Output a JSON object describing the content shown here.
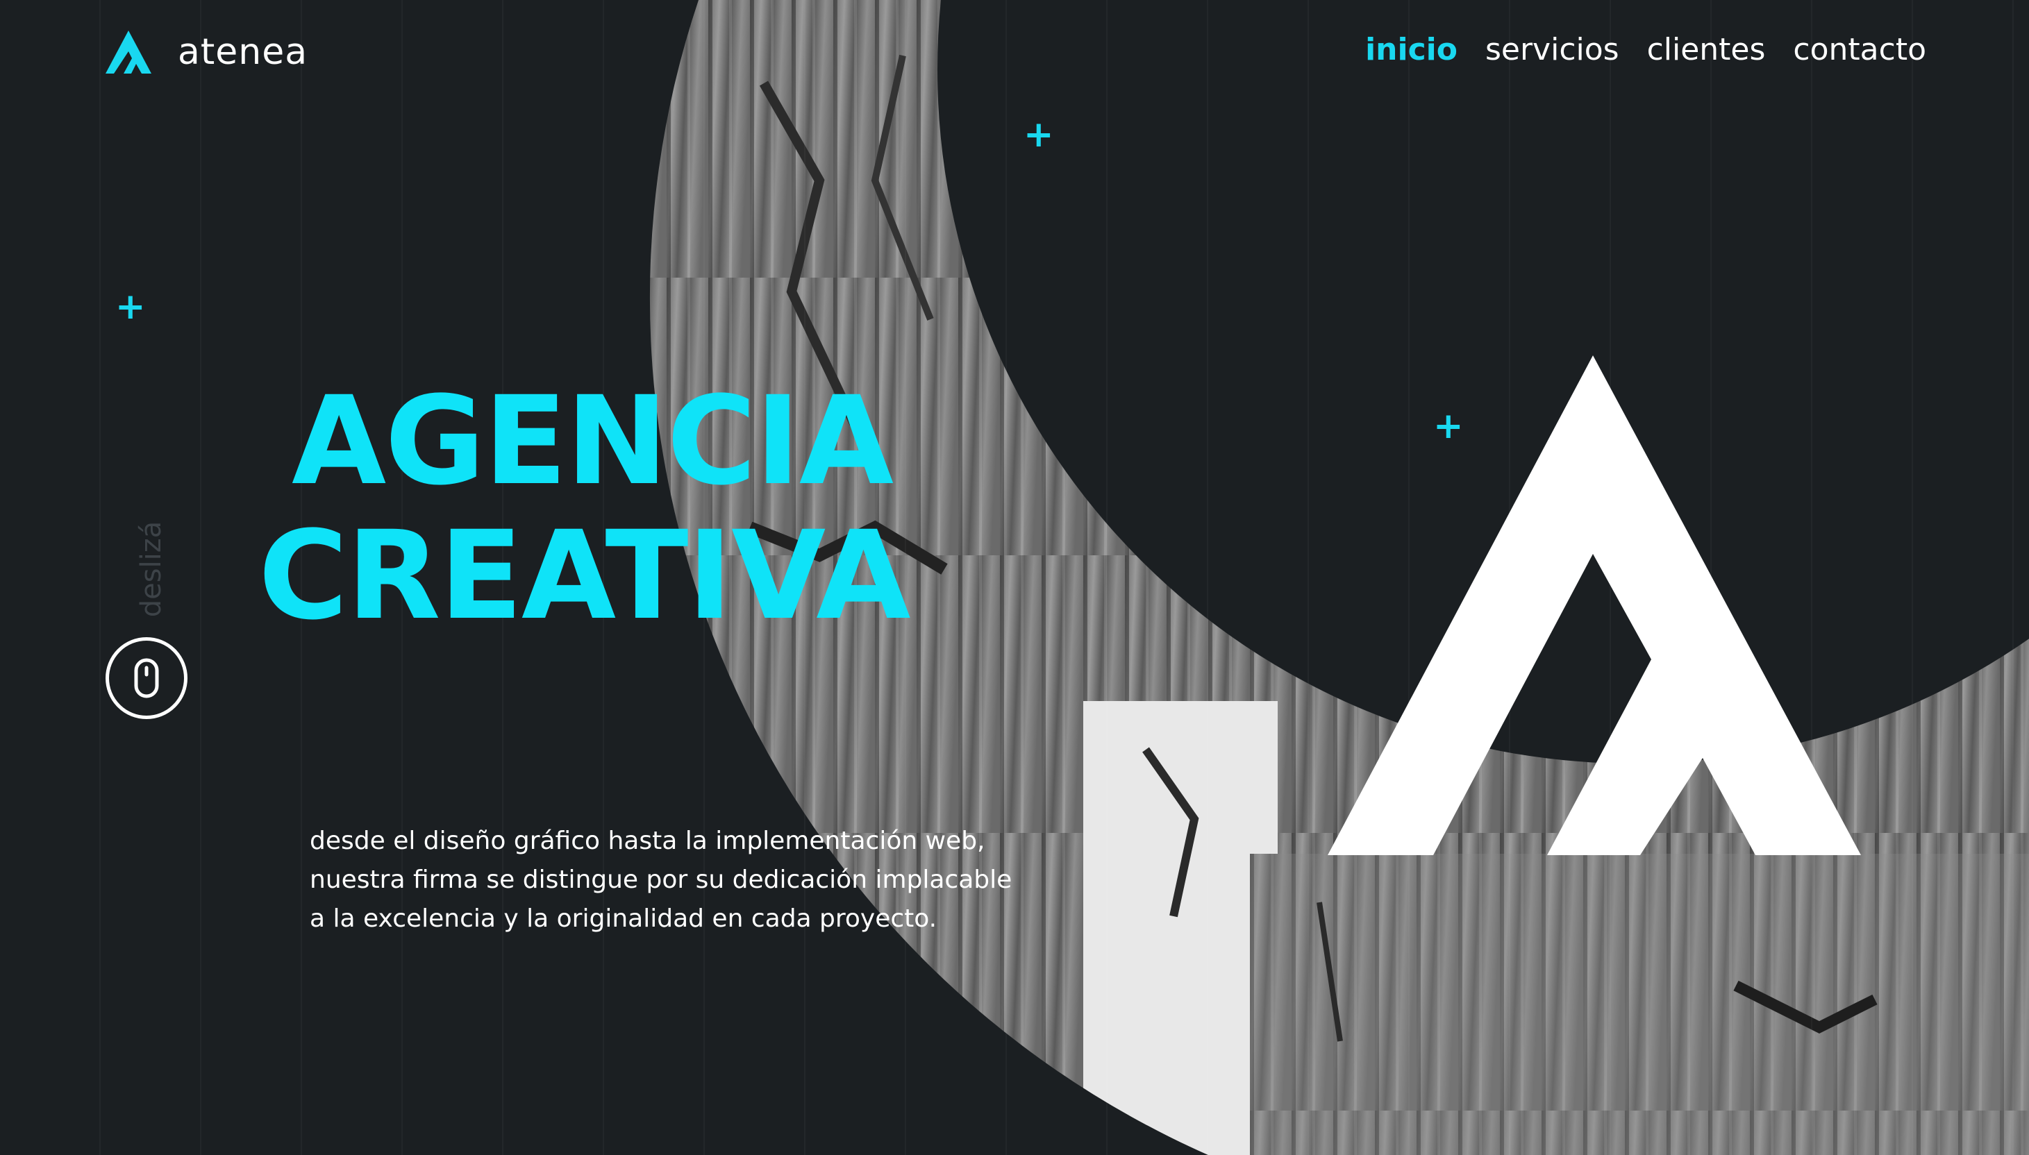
{
  "brand": {
    "name": "atenea",
    "accent_color": "#19d8f0",
    "background_color": "#1b1f22"
  },
  "nav": {
    "items": [
      {
        "label": "inicio",
        "active": true
      },
      {
        "label": "servicios",
        "active": false
      },
      {
        "label": "clientes",
        "active": false
      },
      {
        "label": "contacto",
        "active": false
      }
    ]
  },
  "hero": {
    "title_line1": "AGENCIA",
    "title_line2": "CREATIVA",
    "description": [
      "desde el diseño gráfico hasta la implementación web,",
      "nuestra firma se distingue por su dedicación implacable",
      "a la excelencia y la originalidad en cada proyecto."
    ],
    "scroll_label": "deslizá",
    "big_logo_icon": "atenea-a-logo-icon",
    "background_image": "greek-column-photo"
  },
  "icons": {
    "logo": "atenea-a-logo-icon",
    "mouse": "mouse-scroll-icon",
    "decorations": "plus-icon"
  }
}
